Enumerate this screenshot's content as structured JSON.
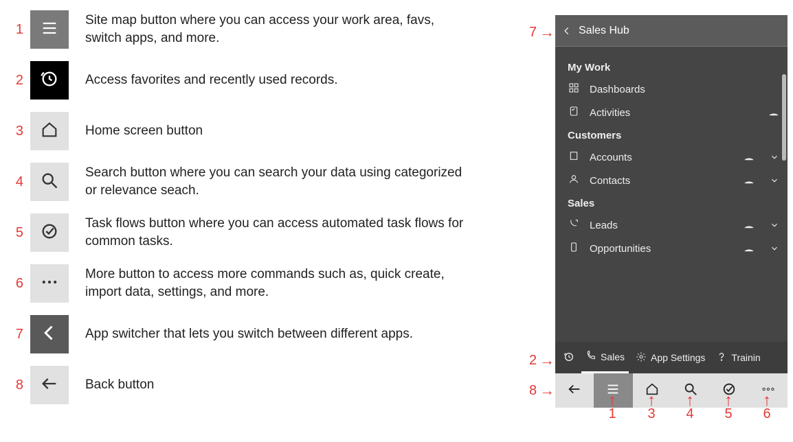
{
  "legend": [
    {
      "n": "1",
      "desc": "Site map button where you can access your work area, favs, switch apps, and more.",
      "tile": "gray",
      "icon": "hamburger"
    },
    {
      "n": "2",
      "desc": "Access favorites and recently used records.",
      "tile": "black",
      "icon": "recent"
    },
    {
      "n": "3",
      "desc": "Home screen button",
      "tile": "light",
      "icon": "home"
    },
    {
      "n": "4",
      "desc": "Search button where you can search your data using categorized or relevance seach.",
      "tile": "light",
      "icon": "search"
    },
    {
      "n": "5",
      "desc": "Task flows button where you can access automated task flows for common tasks.",
      "tile": "light",
      "icon": "taskflow"
    },
    {
      "n": "6",
      "desc": "More button to access more commands such as, quick create, import data, settings, and more.",
      "tile": "light",
      "icon": "dots"
    },
    {
      "n": "7",
      "desc": "App switcher that lets you switch between different apps.",
      "tile": "darkgray",
      "icon": "chev-left"
    },
    {
      "n": "8",
      "desc": "Back button",
      "tile": "light",
      "icon": "arrow-left"
    }
  ],
  "phone": {
    "title": "Sales Hub",
    "sections": [
      {
        "head": "My Work",
        "items": [
          {
            "icon": "dashboard",
            "label": "Dashboards",
            "wifi": false,
            "chev": false
          },
          {
            "icon": "activity",
            "label": "Activities",
            "wifi": true,
            "chev": false
          }
        ]
      },
      {
        "head": "Customers",
        "items": [
          {
            "icon": "account",
            "label": "Accounts",
            "wifi": true,
            "chev": true
          },
          {
            "icon": "contact",
            "label": "Contacts",
            "wifi": true,
            "chev": true
          }
        ]
      },
      {
        "head": "Sales",
        "items": [
          {
            "icon": "lead",
            "label": "Leads",
            "wifi": true,
            "chev": true
          },
          {
            "icon": "opp",
            "label": "Opportunities",
            "wifi": true,
            "chev": true
          }
        ]
      }
    ],
    "areas": [
      {
        "icon": "recent",
        "label": ""
      },
      {
        "icon": "sales-call",
        "label": "Sales",
        "active": true
      },
      {
        "icon": "gear",
        "label": "App Settings"
      },
      {
        "icon": "help",
        "label": "Trainin"
      }
    ],
    "bottom": [
      {
        "icon": "arrow-left"
      },
      {
        "icon": "hamburger",
        "active": true
      },
      {
        "icon": "home"
      },
      {
        "icon": "search"
      },
      {
        "icon": "taskflow"
      },
      {
        "icon": "dots"
      }
    ]
  },
  "callouts": {
    "top": {
      "n": "7"
    },
    "mid": {
      "n": "2"
    },
    "low": {
      "n": "8"
    },
    "bottom": [
      "1",
      "3",
      "4",
      "5",
      "6"
    ]
  }
}
